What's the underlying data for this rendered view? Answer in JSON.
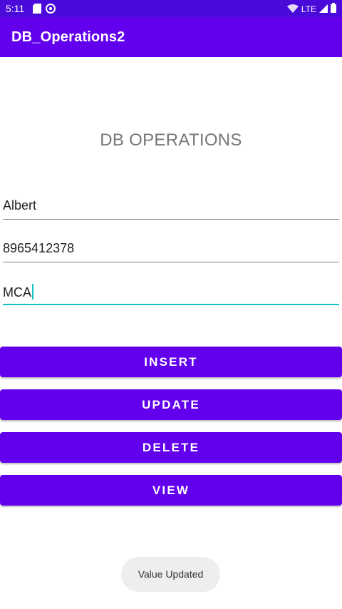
{
  "status_bar": {
    "time": "5:11",
    "network": "LTE",
    "icons": [
      "sd-card-icon",
      "sync-icon",
      "wifi-icon",
      "signal-icon",
      "battery-icon"
    ]
  },
  "app_bar": {
    "title": "DB_Operations2"
  },
  "main": {
    "heading": "DB OPERATIONS",
    "fields": {
      "name": "Albert",
      "phone": "8965412378",
      "course": "MCA"
    },
    "buttons": {
      "insert": "INSERT",
      "update": "UPDATE",
      "delete": "DELETE",
      "view": "VIEW"
    }
  },
  "toast": {
    "message": "Value Updated"
  },
  "colors": {
    "primary": "#6200ee",
    "status_bar": "#4a0ad9",
    "focus_accent": "#14c1c1"
  }
}
